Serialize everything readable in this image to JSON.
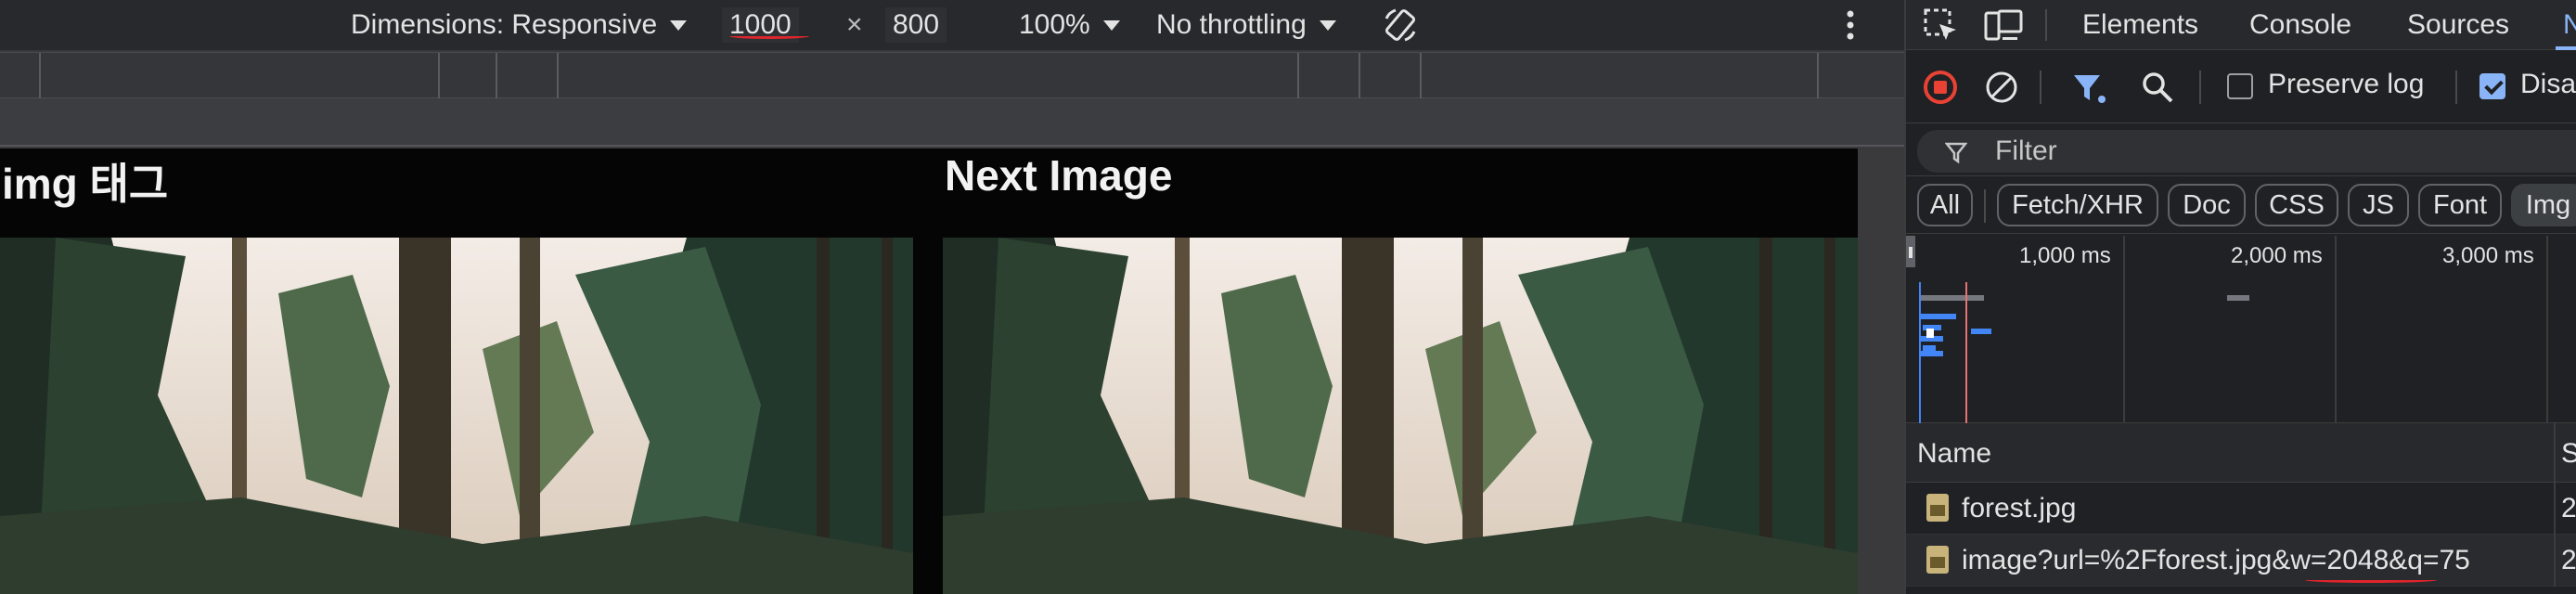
{
  "device_toolbar": {
    "dimensions_label": "Dimensions: Responsive",
    "width_value": "1000",
    "times": "×",
    "height_value": "800",
    "zoom": "100%",
    "throttling": "No throttling"
  },
  "page": {
    "left_image_label": "img 태그",
    "right_image_label": "Next Image"
  },
  "devtools": {
    "tabs": [
      {
        "label": "Elements"
      },
      {
        "label": "Console"
      },
      {
        "label": "Sources"
      },
      {
        "label": "N"
      }
    ],
    "actions": {
      "preserve_log_label": "Preserve log",
      "preserve_log_checked": false,
      "disable_cache_label": "Disa",
      "disable_cache_checked": true
    },
    "filter": {
      "placeholder": "Filter"
    },
    "type_filters": [
      {
        "label": "All",
        "active": false
      },
      {
        "label": "Fetch/XHR",
        "active": false
      },
      {
        "label": "Doc",
        "active": false
      },
      {
        "label": "CSS",
        "active": false
      },
      {
        "label": "JS",
        "active": false
      },
      {
        "label": "Font",
        "active": false
      },
      {
        "label": "Img",
        "active": true
      }
    ],
    "overview": {
      "tick_labels": [
        "1,000 ms",
        "2,000 ms",
        "3,000 ms"
      ]
    },
    "table": {
      "column_name": "Name",
      "column_next": "S",
      "rows": [
        {
          "name": "forest.jpg",
          "extra": "2"
        },
        {
          "name": "image?url=%2Fforest.jpg&w=2048&q=75",
          "extra": "2"
        }
      ]
    },
    "colors": {
      "accent_blue": "#8ab4f8",
      "record_red": "#e94235",
      "annotation_red": "#e0252c"
    }
  }
}
